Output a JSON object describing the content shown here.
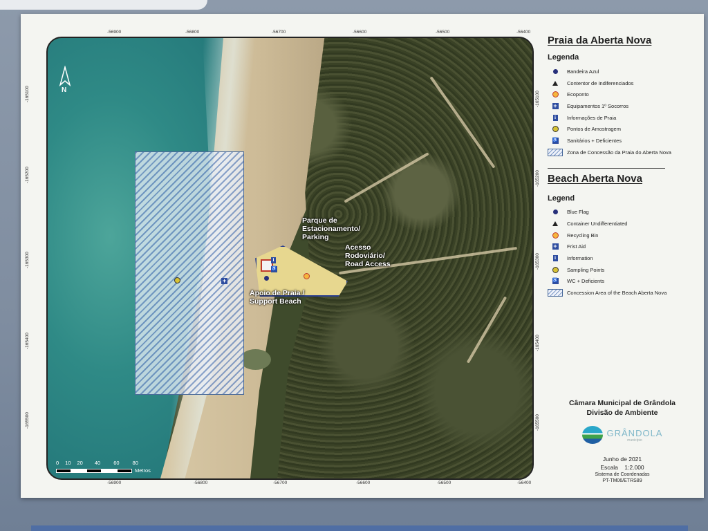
{
  "map": {
    "title_pt": "Praia da Aberta Nova",
    "title_en": "Beach Aberta Nova",
    "labels": {
      "parking": "Parque de Estacionamento/ Parking",
      "road_access": "Acesso Rodoviário/ Road Access",
      "support_beach": "Apoio de Praia / Support Beach"
    },
    "north": "N",
    "scale_bar": {
      "ticks": [
        "0",
        "10",
        "20",
        "40",
        "60",
        "80"
      ],
      "unit": "Metros"
    },
    "coords_x": [
      "-56900",
      "-56800",
      "-56700",
      "-56600",
      "-56500",
      "-56400"
    ],
    "coords_y": [
      "-165100",
      "-165200",
      "-165300",
      "-165400",
      "-165500"
    ]
  },
  "legend_pt": {
    "heading": "Legenda",
    "items": [
      {
        "icon": "blue-flag-icon",
        "label": "Bandeira Azul"
      },
      {
        "icon": "container-icon",
        "label": "Contentor de Indiferenciados"
      },
      {
        "icon": "recycling-icon",
        "label": "Ecoponto"
      },
      {
        "icon": "first-aid-icon",
        "label": "Equipamentos 1º Socorros"
      },
      {
        "icon": "info-icon",
        "label": "Informações de Praia"
      },
      {
        "icon": "sampling-icon",
        "label": "Pontos de Amostragem"
      },
      {
        "icon": "wc-icon",
        "label": "Sanitários + Deficientes"
      },
      {
        "icon": "concession-area-icon",
        "label": "Zona de Concessão da Praia do Aberta Nova"
      }
    ]
  },
  "legend_en": {
    "heading": "Legend",
    "items": [
      {
        "icon": "blue-flag-icon",
        "label": "Blue Flag"
      },
      {
        "icon": "container-icon",
        "label": "Container Undifferentiated"
      },
      {
        "icon": "recycling-icon",
        "label": "Recycling Bin"
      },
      {
        "icon": "first-aid-icon",
        "label": "Frist Aid"
      },
      {
        "icon": "info-icon",
        "label": "Information"
      },
      {
        "icon": "sampling-icon",
        "label": "Sampling Points"
      },
      {
        "icon": "wc-icon",
        "label": "WC + Deficients"
      },
      {
        "icon": "concession-area-icon",
        "label": "Concession Area of the Beach Aberta Nova"
      }
    ]
  },
  "footer": {
    "org_line1": "Câmara Municipal de Grândola",
    "org_line2": "Divisão de Ambiente",
    "logo_text": "GRÂNDOLA",
    "logo_sub": "município",
    "date": "Junho de 2021",
    "scale": "Escala    1:2.000",
    "coord_system_1": "Sistema de Coordenadas",
    "coord_system_2": "PT-TM06/ETRS89"
  },
  "colors": {
    "sea": "#2f8a86",
    "forest": "#3f4b2c",
    "sand": "#d8c9a7",
    "concession_hatch": "#7f9bc8",
    "symbol_blue": "#2e4da0"
  }
}
